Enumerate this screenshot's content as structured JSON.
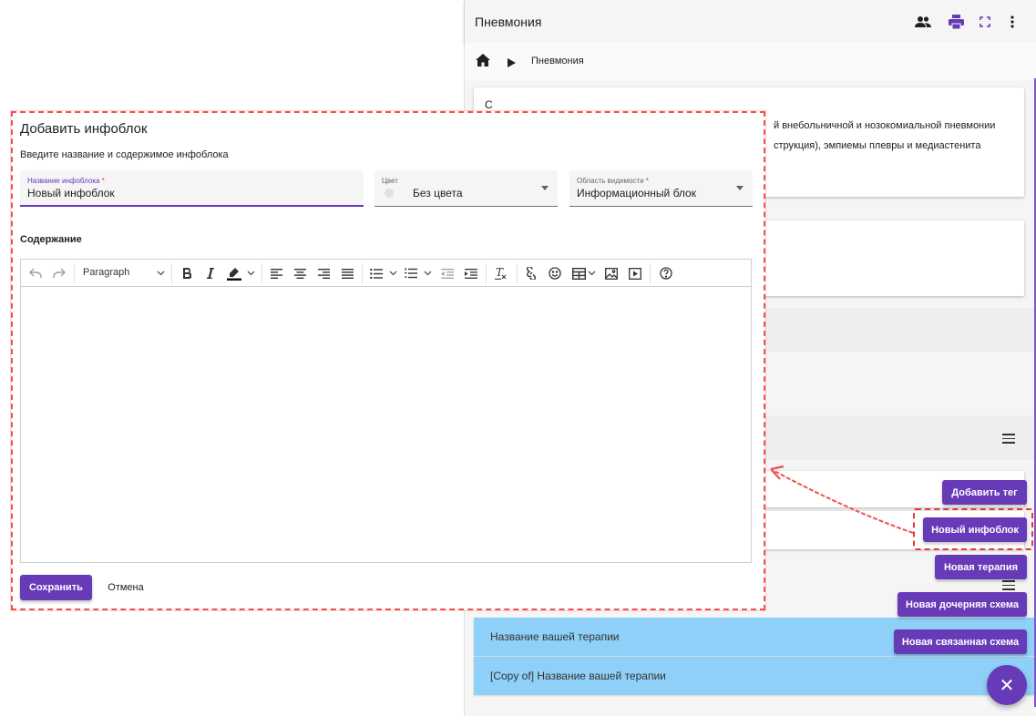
{
  "app": {
    "title": "Пневмония",
    "breadcrumb": "Пневмония",
    "card1_lines": [
      "й внебольничной и нозокомиальной пневмонии",
      "струкция), эмпиемы плевры и медиастенита"
    ],
    "card1_stub": "С",
    "therapies": [
      "Название вашей терапии",
      "[Copy of] Название вашей терапии"
    ]
  },
  "fab": {
    "add_tag": "Добавить тег",
    "new_infoblock": "Новый инфоблок",
    "new_therapy": "Новая терапия",
    "new_child_scheme": "Новая дочерняя схема",
    "new_linked_scheme": "Новая связанная схема",
    "close_symbol": "✕"
  },
  "dialog": {
    "title": "Добавить инфоблок",
    "subtitle": "Введите название и содержимое инфоблока",
    "name_field": {
      "label": "Название инфоблока",
      "required": "*",
      "value": "Новый инфоблок"
    },
    "color_field": {
      "label": "Цвет",
      "value": "Без цвета"
    },
    "scope_field": {
      "label": "Область видимости",
      "required": "*",
      "value": "Информационный блок"
    },
    "content_label": "Содержание",
    "editor": {
      "paragraph_select": "Paragraph",
      "content": ""
    },
    "save": "Сохранить",
    "cancel": "Отмена"
  },
  "colors": {
    "accent": "#673ab7",
    "therapy_row": "#8fd0f8",
    "highlight": "#e53935"
  }
}
